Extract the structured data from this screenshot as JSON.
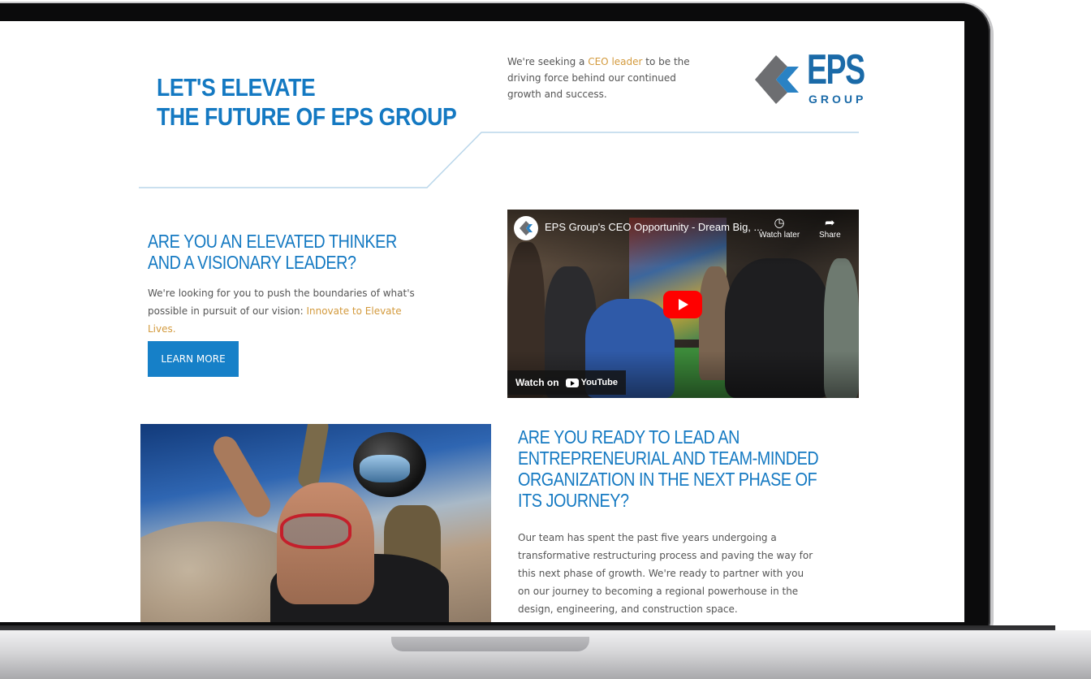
{
  "hero": {
    "title_line1": "LET'S ELEVATE",
    "title_line2": "THE FUTURE OF EPS GROUP",
    "seeking_pre": "We're seeking a ",
    "seeking_link": "CEO leader",
    "seeking_post": " to be the driving force behind our continued growth and success."
  },
  "logo": {
    "main": "EPS",
    "sub": "GROUP"
  },
  "section1": {
    "heading_line1": "ARE YOU AN ELEVATED THINKER",
    "heading_line2": "AND A VISIONARY LEADER?",
    "body_pre": "We're looking for you to push the boundaries of what's possible in pursuit of our vision: ",
    "body_link": "Innovate to Elevate Lives.",
    "button": "LEARN MORE"
  },
  "video": {
    "title": "EPS Group's CEO Opportunity - Dream Big, ...",
    "watch_later": "Watch later",
    "share": "Share",
    "watch_on": "Watch on",
    "youtube": "YouTube"
  },
  "section2": {
    "heading_line1": "ARE YOU READY TO LEAD AN",
    "heading_line2": "ENTREPRENEURIAL AND TEAM-MINDED",
    "heading_line3": "ORGANIZATION IN THE NEXT PHASE OF",
    "heading_line4": "ITS JOURNEY?",
    "body": "Our team has spent the past five years undergoing a transformative restructuring process and paving the way for this next phase of growth. We're ready to partner with you on our journey to becoming a regional powerhouse in the design, engineering, and construction space."
  },
  "colors": {
    "brand_blue": "#1479c2",
    "accent_gold": "#d39a3d",
    "button_blue": "#1680c8"
  }
}
